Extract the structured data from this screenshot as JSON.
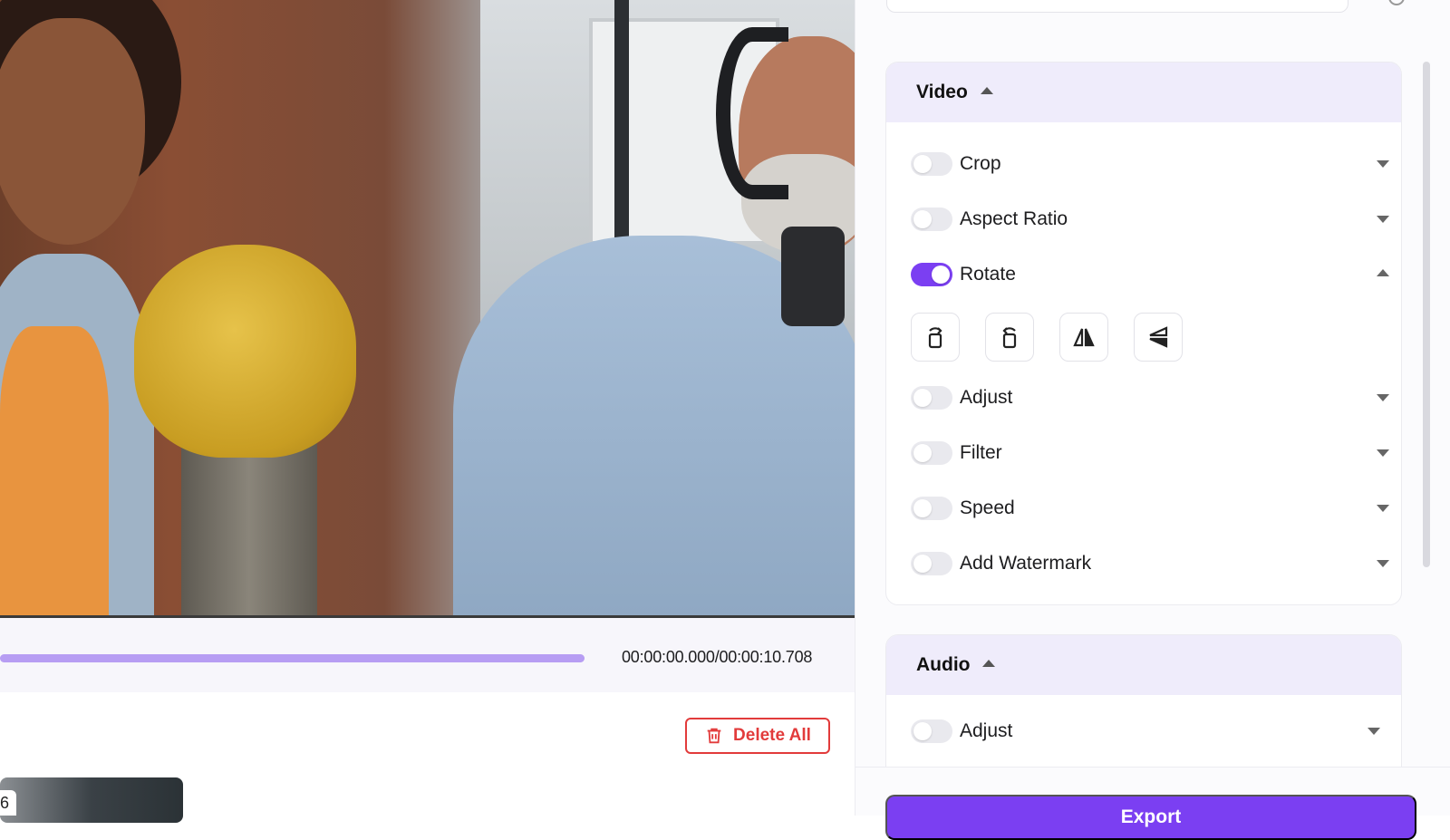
{
  "player": {
    "time_readout": "00:00:00.000/00:00:10.708",
    "progress": 1.0
  },
  "toolbar": {
    "delete_all_label": "Delete All"
  },
  "clip_list": {
    "badge": "6"
  },
  "video_section": {
    "title": "Video",
    "items": [
      {
        "label": "Crop",
        "enabled": false
      },
      {
        "label": "Aspect Ratio",
        "enabled": false
      },
      {
        "label": "Rotate",
        "enabled": true
      },
      {
        "label": "Adjust",
        "enabled": false
      },
      {
        "label": "Filter",
        "enabled": false
      },
      {
        "label": "Speed",
        "enabled": false
      },
      {
        "label": "Add Watermark",
        "enabled": false
      }
    ],
    "rotate_tools": [
      "rotate-right-icon",
      "rotate-left-icon",
      "flip-horizontal-icon",
      "flip-vertical-icon"
    ]
  },
  "audio_section": {
    "title": "Audio",
    "items": [
      {
        "label": "Adjust",
        "enabled": false
      }
    ]
  },
  "export": {
    "label": "Export"
  },
  "colors": {
    "accent": "#7b3ff2",
    "danger": "#e23b3b",
    "progress": "#b79df3",
    "section_header": "#efecfb"
  }
}
